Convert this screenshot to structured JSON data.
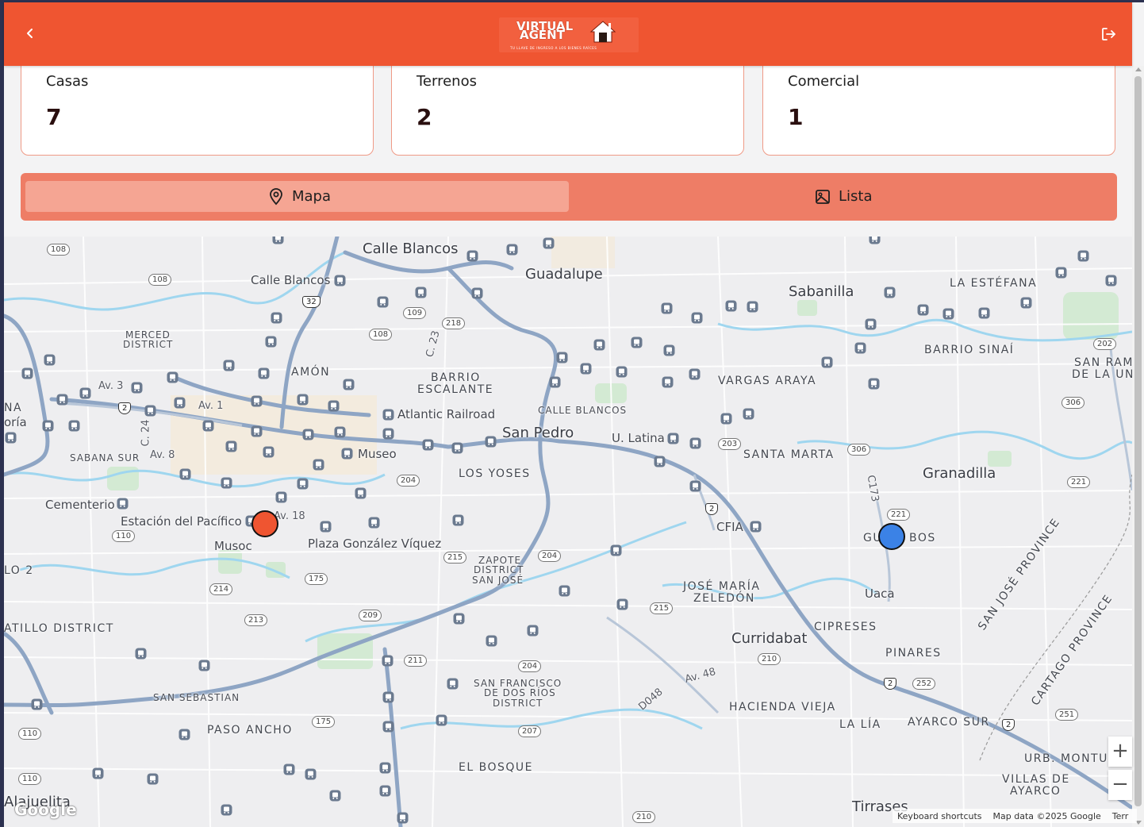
{
  "header": {
    "logo_line1": "VIRTUAL",
    "logo_line2": "AGENT",
    "logo_tagline": "TU LLAVE DE INGRESO A LOS BIENES RAÍCES",
    "accent_color": "#ef5531"
  },
  "stats": [
    {
      "label": "Casas",
      "value": "7"
    },
    {
      "label": "Terrenos",
      "value": "2"
    },
    {
      "label": "Comercial",
      "value": "1"
    }
  ],
  "view_toggle": {
    "map_label": "Mapa",
    "list_label": "Lista",
    "selected": "Mapa",
    "map_icon": "map-pin-icon",
    "list_icon": "image-icon"
  },
  "map": {
    "labels_large": [
      "Calle Blancos",
      "Guadalupe",
      "Sabanilla",
      "San Pedro",
      "Granadilla",
      "Curridabat",
      "Tirrases",
      "Alajuelita"
    ],
    "labels_medium": [
      "Calle Blancos",
      "Atlantic Railroad",
      "Museo",
      "U. Latina",
      "Cementerio",
      "Estación del Pacífico",
      "Musoc",
      "Plaza González Víquez",
      "CFIA",
      "Uaca"
    ],
    "labels_caps": [
      "LA ESTÉFANA",
      "BARRIO SINAÍ",
      "SAN RAM",
      "DE LA UN",
      "VARGAS ARAYA",
      "AMÓN",
      "BARRIO",
      "ESCALANTE",
      "CALLE BLANCOS",
      "SANTA MARTA",
      "LOS YOSES",
      "SABANA SUR",
      "NA",
      "oría",
      "ATILLO DISTRICT",
      "SAN SEBASTIAN",
      "PASO ANCHO",
      "EL BOSQUE",
      "HACIENDA VIEJA",
      "LA LÍA",
      "AYARCO SUR",
      "PINARES",
      "CIPRESES",
      "URB. MONTUI",
      "VILLAS DE",
      "AYARCO",
      "GU",
      "BOS",
      "LO 2"
    ],
    "labels_small": [
      "MERCED",
      "DISTRICT",
      "ZAPOTE",
      "DISTRICT",
      "SAN JOSÉ",
      "JOSÉ MARÍA",
      "ZELEDÓN",
      "SAN FRANCISCO",
      "DE DOS RÍOS",
      "DISTRICT"
    ],
    "labels_road": [
      "Av. 3",
      "Av. 1",
      "Av. 8",
      "C. 24",
      "C. 23",
      "Av. 18",
      "C173",
      "Av. 48",
      "D048"
    ],
    "province_labels": [
      "SAN JOSÉ PROVINCE",
      "CARTAGO PROVINCE"
    ],
    "route_shields": [
      "108",
      "108",
      "109",
      "218",
      "108",
      "202",
      "306",
      "203",
      "306",
      "204",
      "221",
      "221",
      "110",
      "175",
      "214",
      "215",
      "204",
      "215",
      "213",
      "209",
      "211",
      "204",
      "210",
      "252",
      "251",
      "110",
      "175",
      "207",
      "110",
      "210"
    ],
    "us_shields": [
      "32",
      "2",
      "2",
      "2",
      "2"
    ],
    "markers": [
      {
        "name": "property-marker-commercial",
        "color": "#ef5531"
      },
      {
        "name": "property-marker-casa",
        "color": "#3b82e6"
      }
    ],
    "zoom_in": "+",
    "zoom_out": "−",
    "google": "Google",
    "attribution": [
      "Keyboard shortcuts",
      "Map data ©2025 Google",
      "Terr"
    ]
  }
}
